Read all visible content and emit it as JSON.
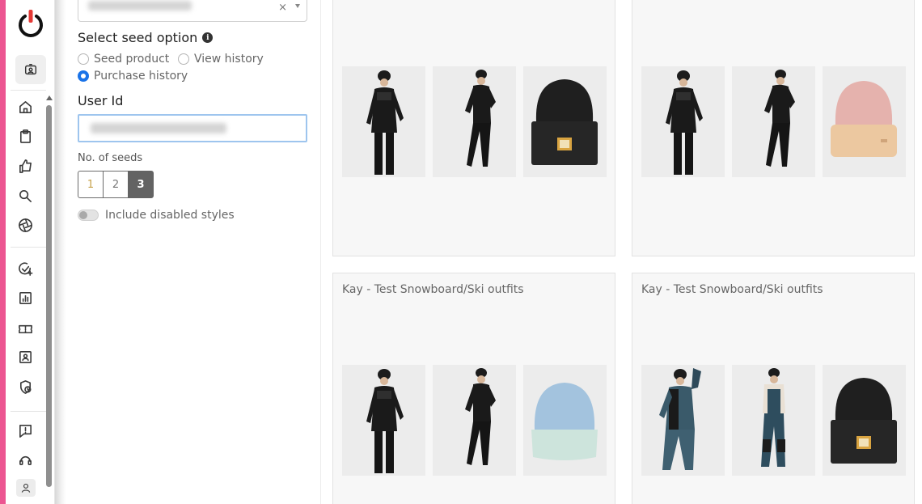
{
  "sidebar": {
    "icons": [
      "power-logo-icon",
      "user-badge-icon",
      "home-icon",
      "clipboard-icon",
      "thumbs-up-icon",
      "search-icon",
      "aperture-icon",
      "check-plus-icon",
      "bar-chart-icon",
      "ticket-icon",
      "contact-card-icon",
      "shield-clock-icon",
      "feedback-icon",
      "support-icon",
      "user-icon"
    ],
    "accent": "#ec5591"
  },
  "panel": {
    "seed_title": "Select seed option",
    "options": [
      {
        "label": "Seed product",
        "checked": false
      },
      {
        "label": "View history",
        "checked": false
      },
      {
        "label": "Purchase history",
        "checked": true
      }
    ],
    "user_id_label": "User Id",
    "seeds_label": "No. of seeds",
    "seeds": [
      "1",
      "2",
      "3"
    ],
    "seeds_selected": "3",
    "toggle_label": "Include disabled styles",
    "toggle_on": false
  },
  "cards": [
    {
      "title": "",
      "products": [
        "jacket-outfit",
        "full-outfit-black",
        "black-beanie"
      ]
    },
    {
      "title": "",
      "products": [
        "jacket-outfit",
        "full-outfit-black",
        "pink-beanie"
      ]
    },
    {
      "title": "Kay - Test Snowboard/Ski outfits",
      "products": [
        "jacket-outfit",
        "full-outfit-black",
        "blue-beanie"
      ]
    },
    {
      "title": "Kay - Test Snowboard/Ski outfits",
      "products": [
        "teal-jacket-outfit",
        "bib-pants-outfit",
        "black-beanie"
      ]
    }
  ]
}
